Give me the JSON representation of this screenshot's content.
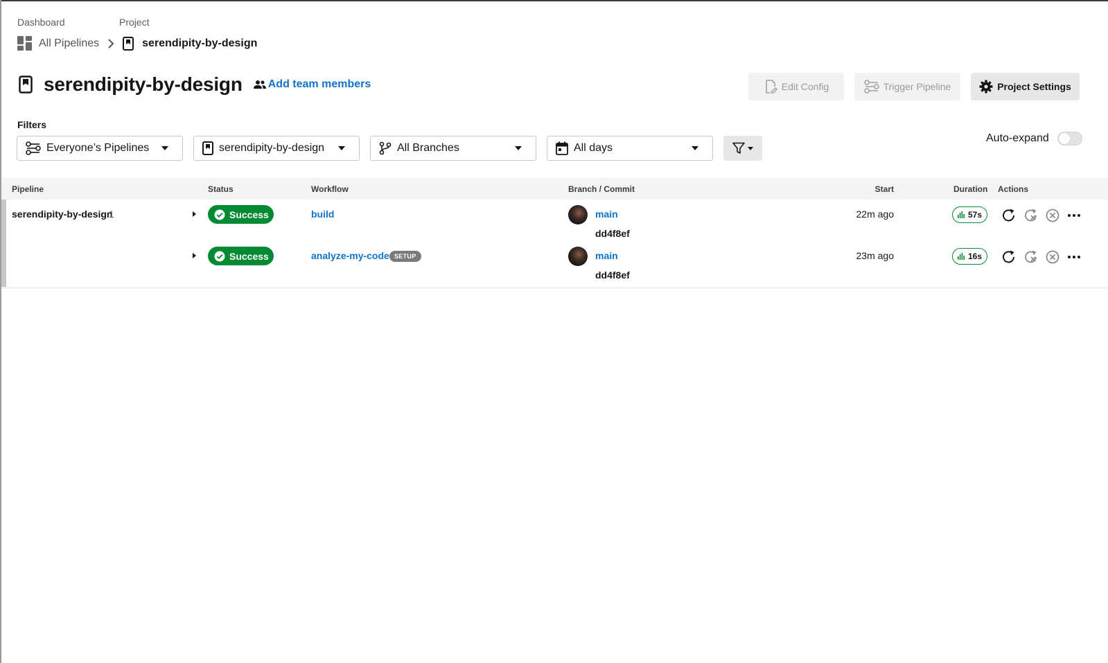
{
  "breadcrumb": {
    "dashboard_label": "Dashboard",
    "project_label": "Project",
    "all_pipelines": "All Pipelines",
    "project_name": "serendipity-by-design"
  },
  "header": {
    "title": "serendipity-by-design",
    "add_team": "Add team members",
    "edit_config": "Edit Config",
    "trigger_pipeline": "Trigger Pipeline",
    "project_settings": "Project Settings"
  },
  "filters": {
    "label": "Filters",
    "pipelines": "Everyone’s Pipelines",
    "project": "serendipity-by-design",
    "branches": "All Branches",
    "days": "All days",
    "auto_expand": "Auto-expand"
  },
  "table": {
    "headers": {
      "pipeline": "Pipeline",
      "status": "Status",
      "workflow": "Workflow",
      "branch_commit": "Branch / Commit",
      "start": "Start",
      "duration": "Duration",
      "actions": "Actions"
    },
    "pipeline_name": "serendipity-by-design",
    "pipeline_number": "1",
    "rows": [
      {
        "status": "Success",
        "workflow": "build",
        "badge": "",
        "branch": "main",
        "commit": "dd4f8ef",
        "start": "22m ago",
        "duration": "57s"
      },
      {
        "status": "Success",
        "workflow": "analyze-my-code",
        "badge": "SETUP",
        "branch": "main",
        "commit": "dd4f8ef",
        "start": "23m ago",
        "duration": "16s"
      }
    ]
  },
  "colors": {
    "success": "#038a33",
    "link": "#0e73cc",
    "setup_badge": "#7a7a7a"
  },
  "icons": {
    "dashboard": "dashboard-icon",
    "project": "bookmark-icon",
    "team": "people-icon",
    "edit_config": "file-edit-icon",
    "trigger": "pipeline-icon",
    "settings": "gear-icon",
    "branch": "git-branch-icon",
    "calendar": "calendar-icon",
    "filter": "filter-icon",
    "rerun": "rerun-icon",
    "rerun_failed": "rerun-failed-icon",
    "cancel": "cancel-icon",
    "more": "more-icon",
    "insights": "bar-chart-icon",
    "check": "check-circle-icon"
  }
}
